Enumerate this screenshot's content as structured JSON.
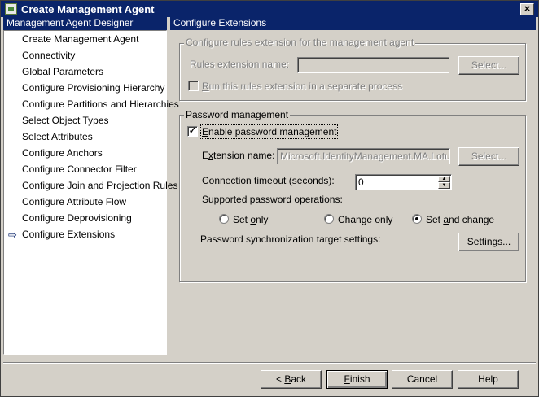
{
  "window": {
    "title": "Create Management Agent",
    "close_glyph": "×"
  },
  "nav": {
    "header": "Management Agent Designer",
    "items": [
      "Create Management Agent",
      "Connectivity",
      "Global Parameters",
      "Configure Provisioning Hierarchy",
      "Configure Partitions and Hierarchies",
      "Select Object Types",
      "Select Attributes",
      "Configure Anchors",
      "Configure Connector Filter",
      "Configure Join and Projection Rules",
      "Configure Attribute Flow",
      "Configure Deprovisioning",
      "Configure Extensions"
    ],
    "current_arrow": "⇨"
  },
  "main": {
    "header": "Configure Extensions",
    "rules_group": {
      "legend": "Configure rules extension for the management agent",
      "name_label": "Rules extension name:",
      "name_value": "",
      "select_button": "Select...",
      "run_separate_label_pre": "",
      "run_separate_label_ul": "R",
      "run_separate_label_post": "un this rules extension in a separate process",
      "run_separate_checked": false
    },
    "password_group": {
      "legend": "Password management",
      "enable_label_pre": "",
      "enable_label_ul": "E",
      "enable_label_post": "nable password management",
      "enable_checked": true,
      "check_mark": "✓",
      "ext_label_pre": "E",
      "ext_label_ul": "x",
      "ext_label_post": "tension name:",
      "ext_value": "Microsoft.IdentityManagement.MA.LotusDom",
      "ext_select_button": "Select...",
      "timeout_label": "Connection timeout (seconds):",
      "timeout_value": "0",
      "supported_label": "Supported password operations:",
      "options": [
        {
          "pre": "Set ",
          "ul": "o",
          "post": "nly",
          "selected": false
        },
        {
          "pre": "Change only",
          "ul": "",
          "post": "",
          "selected": false
        },
        {
          "pre": "Set ",
          "ul": "a",
          "post": "nd change",
          "selected": true
        }
      ],
      "target_label": "Password synchronization target settings:",
      "settings_button_pre": "Se",
      "settings_button_ul": "t",
      "settings_button_post": "tings..."
    }
  },
  "footer": {
    "back_pre": "< ",
    "back_ul": "B",
    "back_post": "ack",
    "finish_pre": "",
    "finish_ul": "F",
    "finish_post": "inish",
    "cancel": "Cancel",
    "help": "Help"
  }
}
